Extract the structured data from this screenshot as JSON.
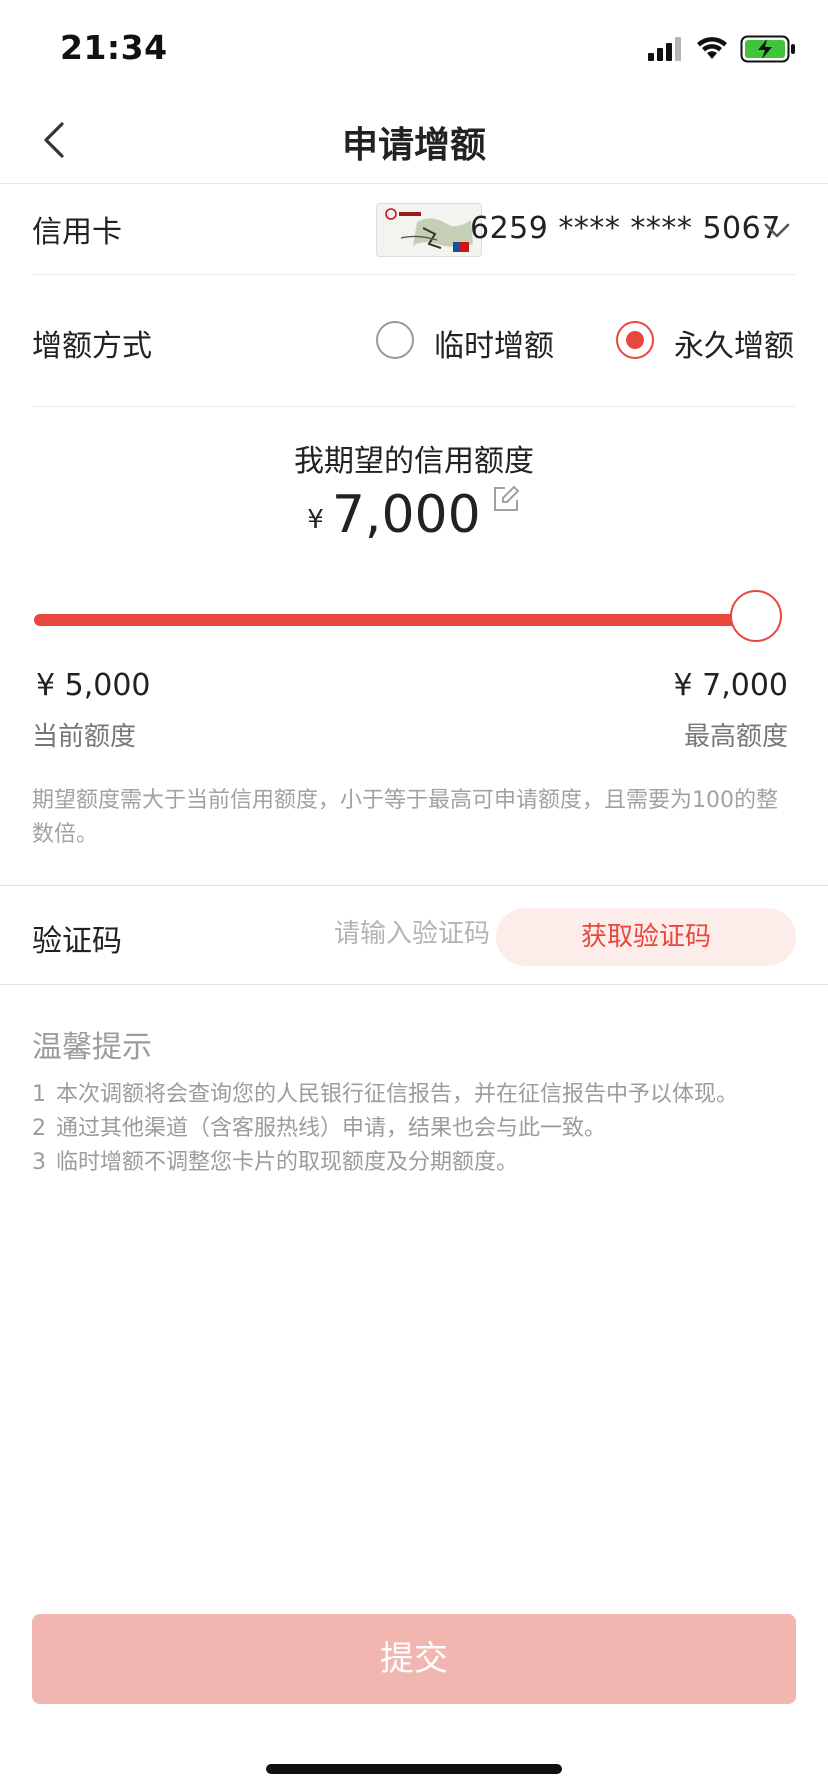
{
  "status_bar": {
    "time": "21:34"
  },
  "nav": {
    "title": "申请增额"
  },
  "credit_card": {
    "label": "信用卡",
    "number": "6259 **** **** 5067"
  },
  "method": {
    "label": "增额方式",
    "options": [
      {
        "label": "临时增额",
        "checked": false
      },
      {
        "label": "永久增额",
        "checked": true
      }
    ]
  },
  "desired": {
    "title": "我期望的信用额度",
    "currency": "¥",
    "amount": "7,000"
  },
  "slider": {
    "min_value": "¥  5,000",
    "min_caption": "当前额度",
    "max_value": "¥  7,000",
    "max_caption": "最高额度",
    "level": 1.0,
    "accent_color": "#e8483c"
  },
  "hint": "期望额度需大于当前信用额度，小于等于最高可申请额度，且需要为100的整数倍。",
  "verify": {
    "label": "验证码",
    "placeholder": "请输入验证码",
    "button_label": "获取验证码"
  },
  "tips": {
    "title": "温馨提示",
    "items": [
      {
        "num": "1",
        "text": "本次调额将会查询您的人民银行征信报告，并在征信报告中予以体现。"
      },
      {
        "num": "2",
        "text": "通过其他渠道（含客服热线）申请，结果也会与此一致。"
      },
      {
        "num": "3",
        "text": "临时增额不调整您卡片的取现额度及分期额度。"
      }
    ]
  },
  "submit": {
    "label": "提交"
  },
  "icons": {
    "back": "chevron-left-icon",
    "chevron": "chevron-down-icon",
    "edit": "edit-icon",
    "signal": "signal-icon",
    "wifi": "wifi-icon",
    "battery": "battery-charging-icon"
  }
}
